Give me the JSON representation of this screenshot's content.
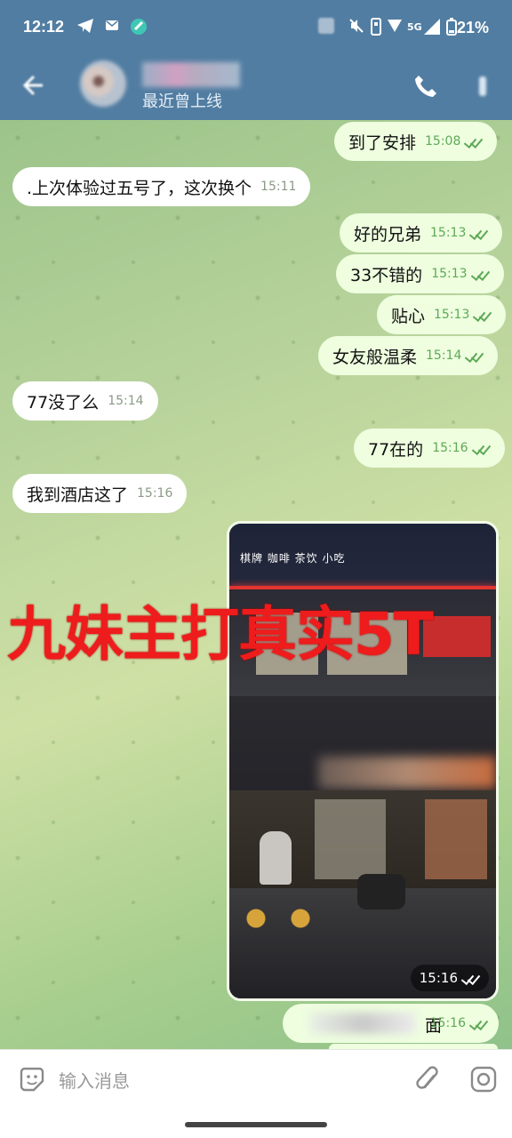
{
  "status_bar": {
    "time": "12:12",
    "battery": "21%",
    "network": "5G"
  },
  "header": {
    "last_seen": "最近曾上线"
  },
  "messages": [
    {
      "dir": "out",
      "text": "到了安排",
      "time": "15:08"
    },
    {
      "dir": "in",
      "text": ".上次体验过五号了，这次换个",
      "time": "15:11"
    },
    {
      "dir": "out",
      "text": "好的兄弟",
      "time": "15:13"
    },
    {
      "dir": "out",
      "text": "33不错的",
      "time": "15:13"
    },
    {
      "dir": "out",
      "text": "贴心",
      "time": "15:13"
    },
    {
      "dir": "out",
      "text": "女友般温柔",
      "time": "15:14"
    },
    {
      "dir": "in",
      "text": "77没了么",
      "time": "15:14"
    },
    {
      "dir": "out",
      "text": "77在的",
      "time": "15:16"
    },
    {
      "dir": "in",
      "text": "我到酒店这了",
      "time": "15:16"
    }
  ],
  "photo": {
    "time": "15:16",
    "sign_text": "棋牌 咖啡 茶饮 小吃"
  },
  "overlay_text": "九妹主打真实5T",
  "partial_message": {
    "text": "面",
    "time": "15:16"
  },
  "input": {
    "placeholder": "输入消息"
  },
  "colors": {
    "header_bg": "#517da2",
    "outgoing_bubble": "#eefedf",
    "incoming_bubble": "#ffffff",
    "overlay_red": "#ee1c1c",
    "tick_green": "#5ea956"
  }
}
